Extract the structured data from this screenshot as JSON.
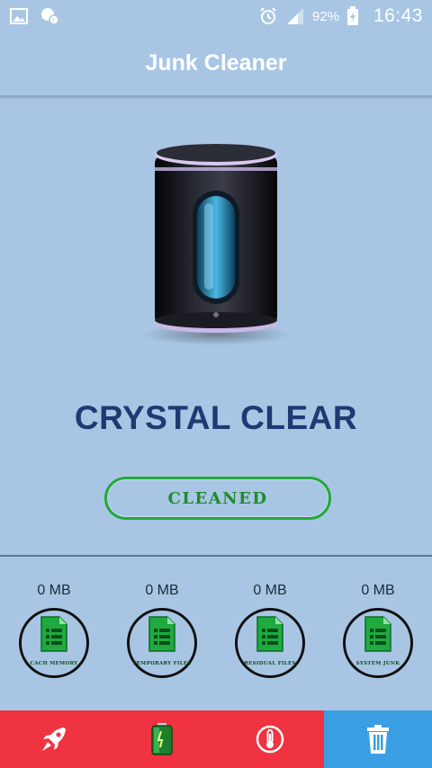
{
  "status_bar": {
    "battery_percent": "92%",
    "time": "16:43",
    "icons": [
      "image-icon",
      "chat-icon",
      "alarm-icon",
      "signal-icon",
      "battery-charging-icon"
    ]
  },
  "app": {
    "title": "Junk Cleaner"
  },
  "main": {
    "status_text": "CRYSTAL CLEAR",
    "button_label": "CLEANED",
    "illustration": "trash-can-illustration"
  },
  "stats": [
    {
      "size": "0 MB",
      "label": "CACH MEMORY",
      "icon": "document-list-icon"
    },
    {
      "size": "0 MB",
      "label": "TEMPORARY FILES",
      "icon": "document-list-icon"
    },
    {
      "size": "0 MB",
      "label": "RESIDUAL FILES",
      "icon": "document-list-icon"
    },
    {
      "size": "0 MB",
      "label": "SYSTEM JUNK",
      "icon": "document-list-icon"
    }
  ],
  "bottom_nav": [
    {
      "icon": "rocket-icon",
      "active": false
    },
    {
      "icon": "battery-icon",
      "active": false
    },
    {
      "icon": "thermometer-icon",
      "active": false
    },
    {
      "icon": "trash-icon",
      "active": true
    }
  ],
  "colors": {
    "background": "#a8c6e4",
    "title_text": "#1d3a72",
    "button_border": "#25a83a",
    "nav_inactive": "#ef3340",
    "nav_active": "#3a9fe2"
  }
}
